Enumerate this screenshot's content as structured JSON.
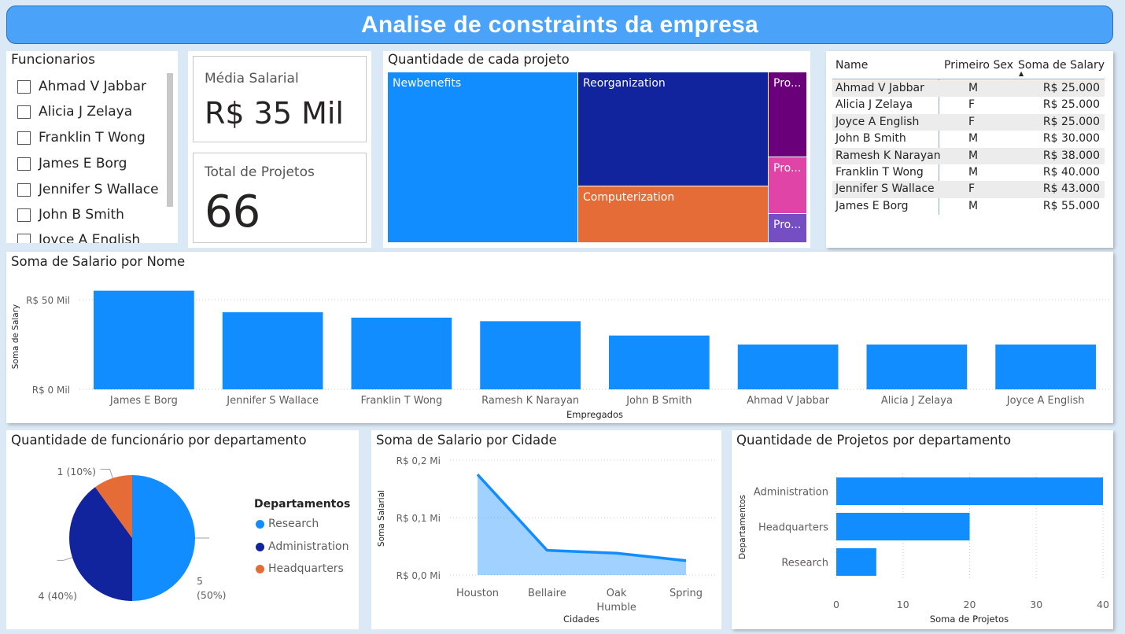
{
  "header": {
    "title": "Analise de constraints da empresa"
  },
  "slicer": {
    "title": "Funcionarios",
    "items": [
      "Ahmad V Jabbar",
      "Alicia J Zelaya",
      "Franklin T Wong",
      "James E Borg",
      "Jennifer S Wallace",
      "John B Smith",
      "Joyce A English"
    ]
  },
  "kpis": {
    "salary": {
      "label": "Média Salarial",
      "value": "R$ 35 Mil"
    },
    "projects": {
      "label": "Total de Projetos",
      "value": "66"
    }
  },
  "treemap": {
    "title": "Quantidade de cada projeto",
    "tiles": [
      {
        "label": "Newbenefits",
        "color": "#118dff"
      },
      {
        "label": "Reorganization",
        "color": "#12239e"
      },
      {
        "label": "Computerization",
        "color": "#e66c37"
      },
      {
        "label": "Pro...",
        "color": "#6b007b"
      },
      {
        "label": "Pro...",
        "color": "#e044a7"
      },
      {
        "label": "Pro...",
        "color": "#744ec2"
      }
    ]
  },
  "table": {
    "headers": [
      "Name",
      "Primeiro Sex",
      "Soma de Salary"
    ],
    "rows": [
      [
        "Ahmad V Jabbar",
        "M",
        "R$ 25.000"
      ],
      [
        "Alicia J Zelaya",
        "F",
        "R$ 25.000"
      ],
      [
        "Joyce A English",
        "F",
        "R$ 25.000"
      ],
      [
        "John B Smith",
        "M",
        "R$ 30.000"
      ],
      [
        "Ramesh K Narayan",
        "M",
        "R$ 38.000"
      ],
      [
        "Franklin T Wong",
        "M",
        "R$ 40.000"
      ],
      [
        "Jennifer S Wallace",
        "F",
        "R$ 43.000"
      ],
      [
        "James E Borg",
        "M",
        "R$ 55.000"
      ]
    ]
  },
  "chart_data": [
    {
      "type": "bar",
      "title": "Soma de Salario por Nome",
      "xlabel": "Empregados",
      "ylabel": "Soma de Salary",
      "yticks": [
        "R$ 0 Mil",
        "R$ 50 Mil"
      ],
      "categories": [
        "James E Borg",
        "Jennifer S Wallace",
        "Franklin T Wong",
        "Ramesh K Narayan",
        "John B Smith",
        "Ahmad V Jabbar",
        "Alicia J Zelaya",
        "Joyce A English"
      ],
      "values": [
        55000,
        43000,
        40000,
        38000,
        30000,
        25000,
        25000,
        25000
      ],
      "ylim": [
        0,
        50000
      ],
      "color": "#118dff",
      "grid": true
    },
    {
      "type": "pie",
      "title": "Quantidade de funcionário por departamento",
      "legend_title": "Departamentos",
      "legend_position": "right",
      "categories": [
        "Research",
        "Administration",
        "Headquarters"
      ],
      "values": [
        5,
        4,
        1
      ],
      "data_labels": [
        "5",
        "(50%)",
        "4 (40%)",
        "1 (10%)"
      ],
      "colors": [
        "#118dff",
        "#12239e",
        "#e66c37"
      ]
    },
    {
      "type": "area",
      "title": "Soma de Salario por Cidade",
      "xlabel": "Cidades",
      "ylabel": "Soma Salarial",
      "yticks": [
        "R$ 0,0 Mi",
        "R$ 0,1 Mi",
        "R$ 0,2 Mi"
      ],
      "categories": [
        "Houston",
        "Bellaire",
        "Oak Humble",
        "Spring"
      ],
      "category_lines": [
        [
          "Houston"
        ],
        [
          "Bellaire"
        ],
        [
          "Oak",
          "Humble"
        ],
        [
          "Spring"
        ]
      ],
      "values": [
        0.175,
        0.043,
        0.038,
        0.025
      ],
      "ylim": [
        0,
        0.2
      ],
      "color": "#118dff",
      "grid": true
    },
    {
      "type": "bar",
      "orientation": "horizontal",
      "title": "Quantidade de Projetos por departamento",
      "xlabel": "Soma de Projetos",
      "ylabel": "Departamentos",
      "categories": [
        "Administration",
        "Headquarters",
        "Research"
      ],
      "values": [
        40,
        20,
        6
      ],
      "xticks": [
        0,
        10,
        20,
        30,
        40
      ],
      "xlim": [
        0,
        40
      ],
      "color": "#118dff",
      "grid": true
    }
  ]
}
